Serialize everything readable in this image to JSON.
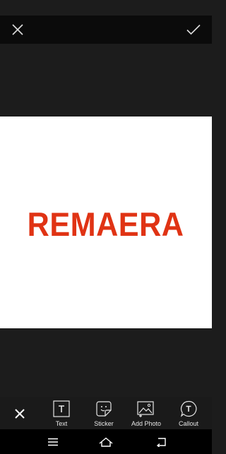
{
  "top_bar": {
    "close_icon": "close-icon",
    "done_icon": "checkmark-icon"
  },
  "canvas": {
    "text": "REMAERA",
    "text_color": "#e03314",
    "background_color": "#ffffff"
  },
  "toolbar": {
    "cancel_icon": "close-icon",
    "tools": [
      {
        "label": "Text",
        "icon": "text-box-icon"
      },
      {
        "label": "Sticker",
        "icon": "sticker-icon"
      },
      {
        "label": "Add Photo",
        "icon": "add-photo-icon"
      },
      {
        "label": "Callout",
        "icon": "callout-icon"
      }
    ]
  },
  "nav_bar": {
    "menu_icon": "menu-icon",
    "home_icon": "home-icon",
    "back_icon": "back-icon"
  }
}
